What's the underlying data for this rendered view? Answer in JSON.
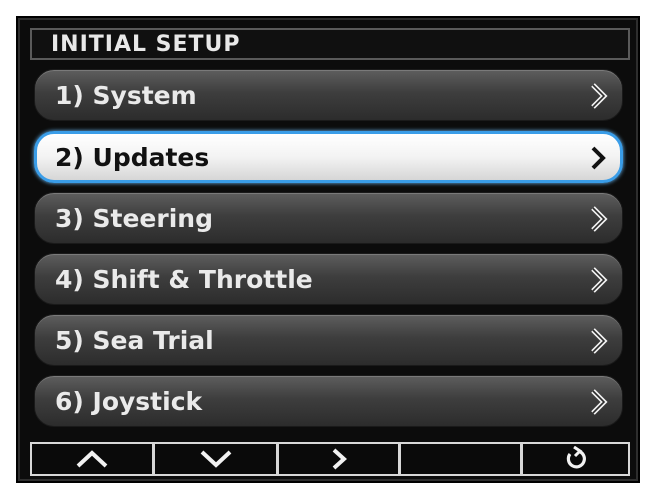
{
  "header": {
    "title": "INITIAL SETUP"
  },
  "menu": {
    "selected_index": 1,
    "items": [
      {
        "label": "1) System",
        "icon": "chevron-right-icon"
      },
      {
        "label": "2) Updates",
        "icon": "chevron-right-icon"
      },
      {
        "label": "3) Steering",
        "icon": "chevron-right-icon"
      },
      {
        "label": "4) Shift & Throttle",
        "icon": "chevron-right-icon"
      },
      {
        "label": "5) Sea Trial",
        "icon": "chevron-right-icon"
      },
      {
        "label": "6) Joystick",
        "icon": "chevron-right-icon"
      }
    ]
  },
  "softkeys": [
    {
      "icon": "chevron-up-icon"
    },
    {
      "icon": "chevron-down-icon"
    },
    {
      "icon": "chevron-right-icon"
    },
    {
      "icon": ""
    },
    {
      "icon": "refresh-icon"
    }
  ],
  "colors": {
    "screen_background": "#0c0c0c",
    "item_gradient_top": "#5e5e5e",
    "item_gradient_bottom": "#2c2c2c",
    "selected_background": "#f3f3f3",
    "selected_border": "#3a9de8",
    "text_light": "#eaeaea",
    "text_dark": "#111111"
  }
}
